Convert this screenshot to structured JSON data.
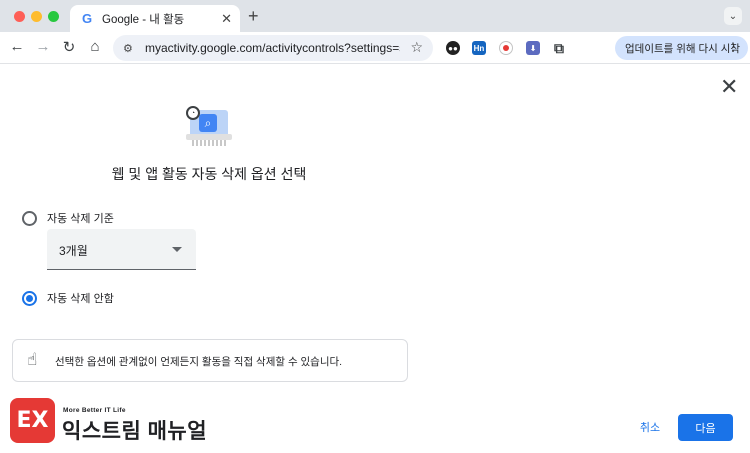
{
  "browser": {
    "tab_title": "Google - 내 활동",
    "tab_favicon": "G",
    "new_tab_glyph": "+",
    "tab_close_glyph": "✕",
    "tab_menu_glyph": "⌄",
    "url": "myactivity.google.com/activitycontrols?settings=s...",
    "update_button_label": "업데이트를 위해 다시 시작",
    "update_menu_glyph": "⋮",
    "extension_hn_label": "Hn",
    "icons": [
      "back-icon",
      "forward-icon",
      "reload-icon",
      "home-icon",
      "site-settings-icon",
      "bookmark-star-icon",
      "extension-mask-icon",
      "extension-hn-icon",
      "extension-record-icon",
      "extension-download-icon",
      "extensions-puzzle-icon"
    ]
  },
  "dialog": {
    "close_glyph": "✕",
    "title": "웹 및 앱 활동 자동 삭제 옵션 선택",
    "options": [
      {
        "label": "자동 삭제 기준",
        "selected": false
      },
      {
        "label": "자동 삭제 안함",
        "selected": true
      }
    ],
    "period_select": {
      "value": "3개월"
    },
    "info_text": "선택한 옵션에 관계없이 언제든지 활동을 직접 삭제할 수 있습니다.",
    "cancel_label": "취소",
    "next_label": "다음"
  },
  "watermark": {
    "logo_text": "EX",
    "tagline": "More Better IT Life",
    "brand": "익스트림 매뉴얼"
  },
  "colors": {
    "accent": "#1a73e8",
    "logo": "#e53935"
  }
}
